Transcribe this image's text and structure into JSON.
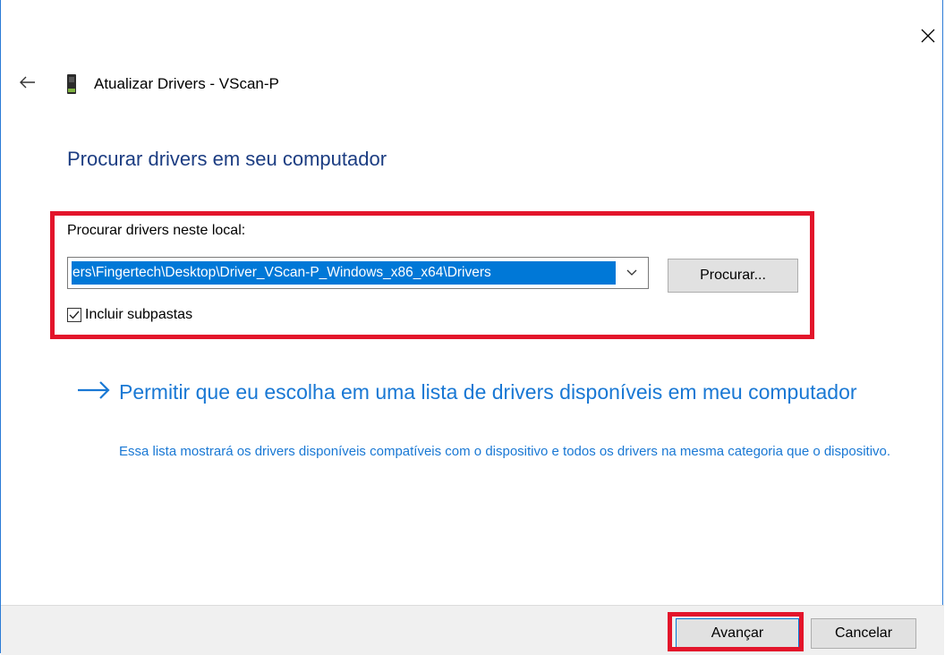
{
  "window": {
    "title": "Atualizar Drivers - VScan-P",
    "close_icon": "close-icon",
    "back_icon": "back-arrow-icon",
    "device_icon": "device-icon"
  },
  "main": {
    "heading": "Procurar drivers em seu computador",
    "location_label": "Procurar drivers neste local:",
    "path_value": "ers\\Fingertech\\Desktop\\Driver_VScan-P_Windows_x86_x64\\Drivers",
    "browse_label": "Procurar...",
    "include_subfolders_label": "Incluir subpastas",
    "include_subfolders_checked": true,
    "pick_list_link": {
      "title": "Permitir que eu escolha em uma lista de drivers disponíveis em meu computador",
      "description": "Essa lista mostrará os drivers disponíveis compatíveis com o dispositivo e todos os drivers na mesma categoria que o dispositivo."
    }
  },
  "footer": {
    "next_label": "Avançar",
    "cancel_label": "Cancelar"
  },
  "colors": {
    "accent": "#0078d7",
    "heading": "#1c3d82",
    "link": "#1978d4",
    "highlight": "#e3152b",
    "footer_bg": "#f0f0f0"
  }
}
